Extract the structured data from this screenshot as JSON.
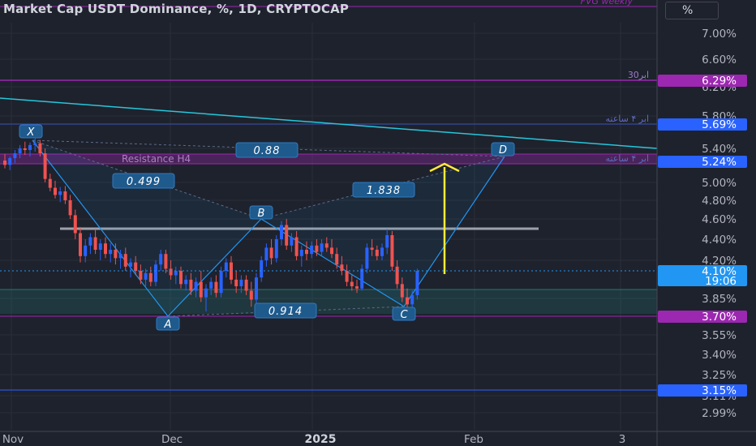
{
  "header": {
    "title": "Market Cap USDT Dominance, %, 1D, CRYPTOCAP",
    "unit_button": "%"
  },
  "colors": {
    "background": "#1e222d",
    "candle_up": "#2962ff",
    "candle_down": "#ef5350",
    "pattern_line": "#2196f3",
    "trend_line": "#26c6da",
    "arrow": "#ffeb3b",
    "resistance_zone": "#9c27b0",
    "support_zone": "#26a69a"
  },
  "chart_data": {
    "type": "candlestick",
    "title": "Market Cap USDT Dominance, %, 1D, CRYPTOCAP",
    "y_ticks": [
      "7.00%",
      "6.60%",
      "6.20%",
      "5.80%",
      "5.40%",
      "5.00%",
      "4.80%",
      "4.60%",
      "4.40%",
      "4.20%",
      "3.85%",
      "3.55%",
      "3.40%",
      "3.25%",
      "3.11%",
      "2.99%"
    ],
    "x_ticks": [
      {
        "label": "Nov",
        "bold": false
      },
      {
        "label": "Dec",
        "bold": false
      },
      {
        "label": "2025",
        "bold": true
      },
      {
        "label": "Feb",
        "bold": false
      },
      {
        "label": "3",
        "bold": false
      }
    ],
    "price_badges": [
      {
        "label": "6.29%",
        "color": "#9c27b0"
      },
      {
        "label": "5.69%",
        "color": "#2962ff"
      },
      {
        "label": "5.24%",
        "color": "#2962ff"
      },
      {
        "label": "4.10%",
        "sub": "19:06",
        "color": "#2196f3"
      },
      {
        "label": "3.70%",
        "color": "#9c27b0"
      },
      {
        "label": "3.15%",
        "color": "#2962ff"
      }
    ],
    "horizontal_levels": [
      {
        "label": "ابر30",
        "color": "#9c27b0"
      },
      {
        "label": "ابر ۴ ساعته",
        "color": "#3f51b5"
      },
      {
        "label": "ابر ۴ ساعته",
        "color": "#3f51b5"
      },
      {
        "label": "FVG weekly",
        "color": "#9c27b0"
      }
    ],
    "zones": [
      {
        "label": "Resistance H4",
        "color": "#9c27b0"
      },
      {
        "label": "",
        "color": "#26a69a"
      }
    ],
    "pattern_points": [
      "X",
      "A",
      "B",
      "C",
      "D"
    ],
    "fib_ratios": [
      "0.499",
      "0.88",
      "1.838",
      "0.914"
    ],
    "candles": [
      [
        5.25,
        5.33,
        5.16,
        5.2
      ],
      [
        5.2,
        5.3,
        5.14,
        5.28
      ],
      [
        5.28,
        5.38,
        5.22,
        5.34
      ],
      [
        5.34,
        5.44,
        5.28,
        5.4
      ],
      [
        5.4,
        5.48,
        5.32,
        5.38
      ],
      [
        5.38,
        5.47,
        5.3,
        5.44
      ],
      [
        5.44,
        5.52,
        5.36,
        5.46
      ],
      [
        5.46,
        5.5,
        5.3,
        5.34
      ],
      [
        5.34,
        5.4,
        5.0,
        5.04
      ],
      [
        5.04,
        5.1,
        4.9,
        4.94
      ],
      [
        4.94,
        5.02,
        4.82,
        4.86
      ],
      [
        4.86,
        4.95,
        4.78,
        4.9
      ],
      [
        4.9,
        4.96,
        4.76,
        4.8
      ],
      [
        4.8,
        4.86,
        4.6,
        4.64
      ],
      [
        4.64,
        4.7,
        4.4,
        4.46
      ],
      [
        4.46,
        4.52,
        4.18,
        4.24
      ],
      [
        4.24,
        4.4,
        4.18,
        4.34
      ],
      [
        4.34,
        4.46,
        4.26,
        4.42
      ],
      [
        4.42,
        4.5,
        4.26,
        4.3
      ],
      [
        4.3,
        4.4,
        4.2,
        4.36
      ],
      [
        4.36,
        4.42,
        4.22,
        4.26
      ],
      [
        4.26,
        4.36,
        4.18,
        4.3
      ],
      [
        4.3,
        4.36,
        4.16,
        4.22
      ],
      [
        4.22,
        4.3,
        4.12,
        4.26
      ],
      [
        4.26,
        4.32,
        4.1,
        4.14
      ],
      [
        4.14,
        4.22,
        4.04,
        4.18
      ],
      [
        4.18,
        4.24,
        4.06,
        4.1
      ],
      [
        4.1,
        4.16,
        3.98,
        4.02
      ],
      [
        4.02,
        4.12,
        3.96,
        4.08
      ],
      [
        4.08,
        4.14,
        3.96,
        4.0
      ],
      [
        4.0,
        4.2,
        3.96,
        4.16
      ],
      [
        4.16,
        4.3,
        4.1,
        4.26
      ],
      [
        4.26,
        4.3,
        4.08,
        4.12
      ],
      [
        4.12,
        4.2,
        4.02,
        4.06
      ],
      [
        4.06,
        4.14,
        3.98,
        4.1
      ],
      [
        4.1,
        4.14,
        3.94,
        3.98
      ],
      [
        3.98,
        4.06,
        3.92,
        4.02
      ],
      [
        4.02,
        4.08,
        3.88,
        3.92
      ],
      [
        3.92,
        4.04,
        3.86,
        4.0
      ],
      [
        4.0,
        4.1,
        3.82,
        3.86
      ],
      [
        3.86,
        3.98,
        3.74,
        3.94
      ],
      [
        3.94,
        4.04,
        3.88,
        4.0
      ],
      [
        4.0,
        4.06,
        3.86,
        3.9
      ],
      [
        3.9,
        4.14,
        3.86,
        4.1
      ],
      [
        4.1,
        4.22,
        4.04,
        4.18
      ],
      [
        4.18,
        4.24,
        3.98,
        4.02
      ],
      [
        4.02,
        4.1,
        3.9,
        3.96
      ],
      [
        3.96,
        4.06,
        3.9,
        4.02
      ],
      [
        4.02,
        4.06,
        3.88,
        3.92
      ],
      [
        3.92,
        4.0,
        3.78,
        3.84
      ],
      [
        3.84,
        4.08,
        3.8,
        4.04
      ],
      [
        4.04,
        4.24,
        4.0,
        4.2
      ],
      [
        4.2,
        4.36,
        4.14,
        4.32
      ],
      [
        4.32,
        4.4,
        4.16,
        4.22
      ],
      [
        4.22,
        4.44,
        4.18,
        4.4
      ],
      [
        4.4,
        4.58,
        4.34,
        4.54
      ],
      [
        4.54,
        4.6,
        4.3,
        4.34
      ],
      [
        4.34,
        4.46,
        4.28,
        4.42
      ],
      [
        4.42,
        4.48,
        4.2,
        4.24
      ],
      [
        4.24,
        4.34,
        4.14,
        4.3
      ],
      [
        4.3,
        4.38,
        4.2,
        4.26
      ],
      [
        4.26,
        4.38,
        4.22,
        4.34
      ],
      [
        4.34,
        4.4,
        4.24,
        4.28
      ],
      [
        4.28,
        4.4,
        4.24,
        4.36
      ],
      [
        4.36,
        4.42,
        4.28,
        4.32
      ],
      [
        4.32,
        4.4,
        4.22,
        4.26
      ],
      [
        4.26,
        4.32,
        4.12,
        4.16
      ],
      [
        4.16,
        4.24,
        4.06,
        4.1
      ],
      [
        4.1,
        4.16,
        3.96,
        4.0
      ],
      [
        4.0,
        4.06,
        3.92,
        3.96
      ],
      [
        3.96,
        4.02,
        3.9,
        3.94
      ],
      [
        3.94,
        4.16,
        3.92,
        4.12
      ],
      [
        4.12,
        4.36,
        4.08,
        4.32
      ],
      [
        4.32,
        4.4,
        4.24,
        4.3
      ],
      [
        4.3,
        4.34,
        4.2,
        4.24
      ],
      [
        4.24,
        4.36,
        4.2,
        4.32
      ],
      [
        4.32,
        4.5,
        4.26,
        4.44
      ],
      [
        4.44,
        4.48,
        4.1,
        4.14
      ],
      [
        4.14,
        4.2,
        3.94,
        3.98
      ],
      [
        3.98,
        4.04,
        3.82,
        3.86
      ],
      [
        3.86,
        3.94,
        3.76,
        3.8
      ],
      [
        3.8,
        3.92,
        3.76,
        3.88
      ],
      [
        3.88,
        4.12,
        3.84,
        4.1
      ]
    ]
  }
}
